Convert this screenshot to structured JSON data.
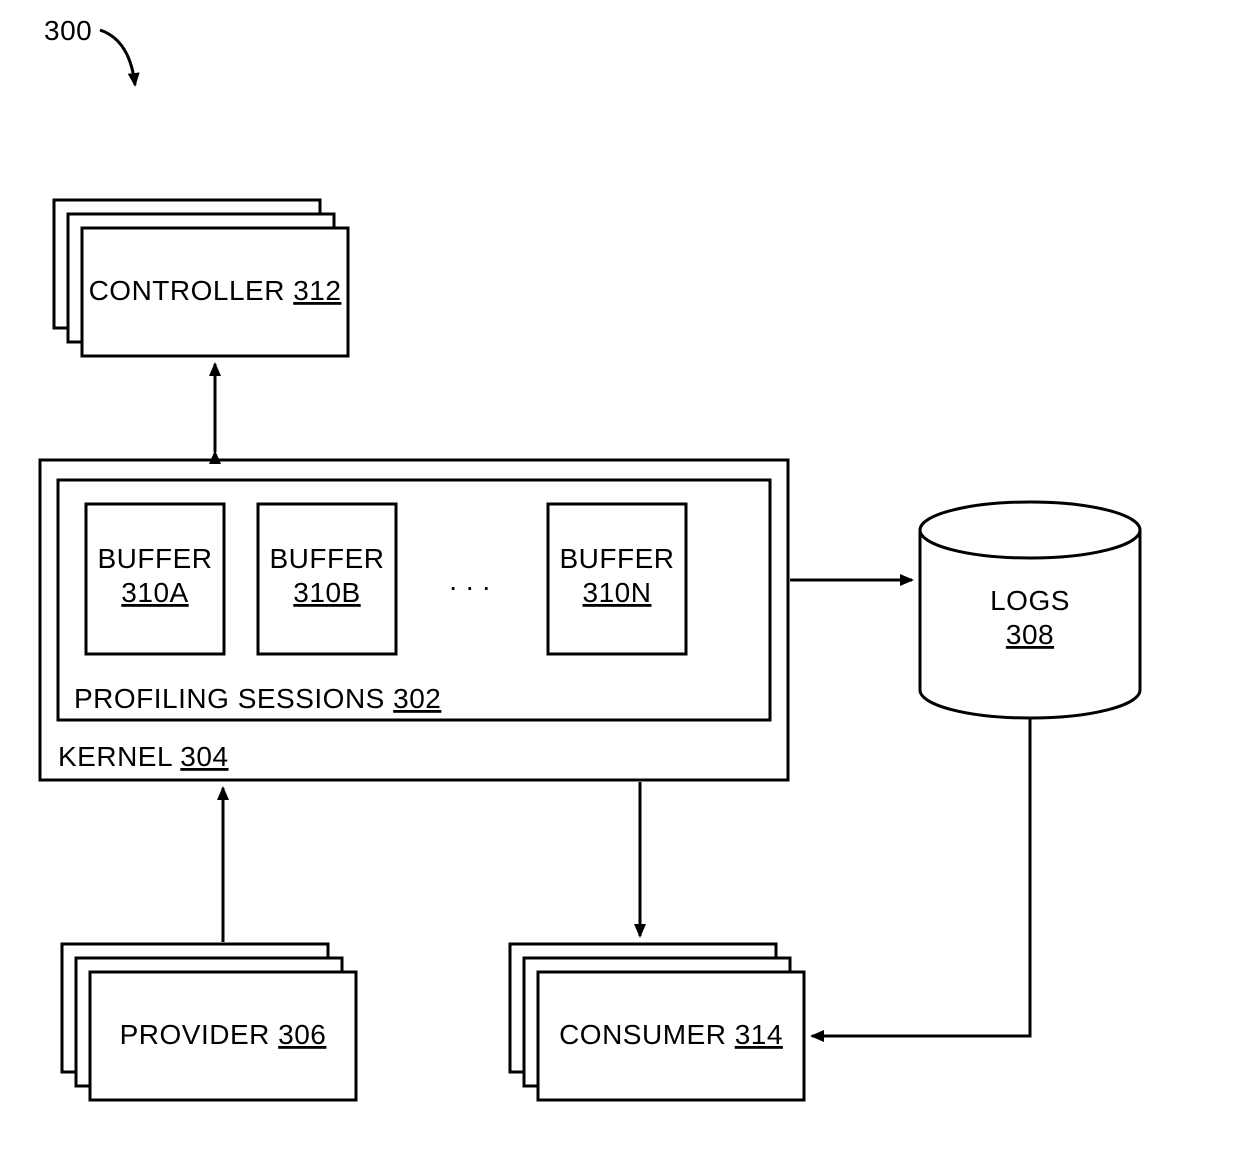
{
  "figure_ref": "300",
  "controller": {
    "label": "CONTROLLER",
    "ref": "312"
  },
  "kernel": {
    "label": "KERNEL",
    "ref": "304"
  },
  "profiling": {
    "label": "PROFILING SESSIONS",
    "ref": "302"
  },
  "buffers": {
    "a": {
      "label": "BUFFER",
      "ref": "310A"
    },
    "b": {
      "label": "BUFFER",
      "ref": "310B"
    },
    "n": {
      "label": "BUFFER",
      "ref": "310N"
    }
  },
  "ellipsis": ". . .",
  "provider": {
    "label": "PROVIDER",
    "ref": "306"
  },
  "consumer": {
    "label": "CONSUMER",
    "ref": "314"
  },
  "logs": {
    "label": "LOGS",
    "ref": "308"
  }
}
